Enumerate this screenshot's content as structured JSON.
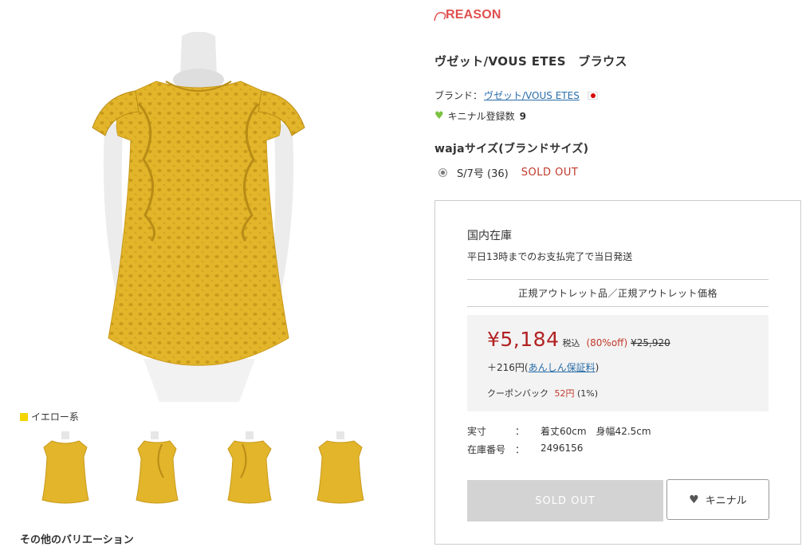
{
  "colors": {
    "accent_red": "#c0392b",
    "price_red": "#b22222",
    "link_blue": "#2a6ea8",
    "swatch_yellow": "#f5d400",
    "favorite_green": "#7cc242",
    "product_yellow": "#e2b52a"
  },
  "gallery": {
    "color_name": "イエロー系",
    "variation_heading": "その他のバリエーション"
  },
  "shop": {
    "logo_text": "REASON"
  },
  "product": {
    "title": "ヴゼット/VOUS ETES　ブラウス",
    "brand_label": "ブランド：",
    "brand_name": "ヴゼット/VOUS ETES",
    "favorite_label": "キニナル登録数",
    "favorite_count": "9"
  },
  "size": {
    "heading": "wajaサイズ(ブランドサイズ)",
    "option": "S/7号 (36)",
    "status": "SOLD OUT"
  },
  "buy_box": {
    "stock_title": "国内在庫",
    "ship_note": "平日13時までのお支払完了で当日発送",
    "outlet_label": "正規アウトレット品／正規アウトレット価格",
    "price": "¥5,184",
    "tax_label": "税込",
    "discount": "(80%off)",
    "original_price": "¥25,920",
    "guarantee_prefix": "＋216円(",
    "guarantee_link": "あんしん保証料",
    "guarantee_suffix": ")",
    "coupon_label": "クーポンバック",
    "coupon_amount": "52円",
    "coupon_rate": "(1%)",
    "specs": [
      {
        "key": "実寸",
        "colon": "：",
        "value": "着丈60cm　身幅42.5cm"
      },
      {
        "key": "在庫番号",
        "colon": "：",
        "value": "2496156"
      }
    ],
    "sold_out_button": "SOLD OUT",
    "favorite_button": "キニナル"
  }
}
